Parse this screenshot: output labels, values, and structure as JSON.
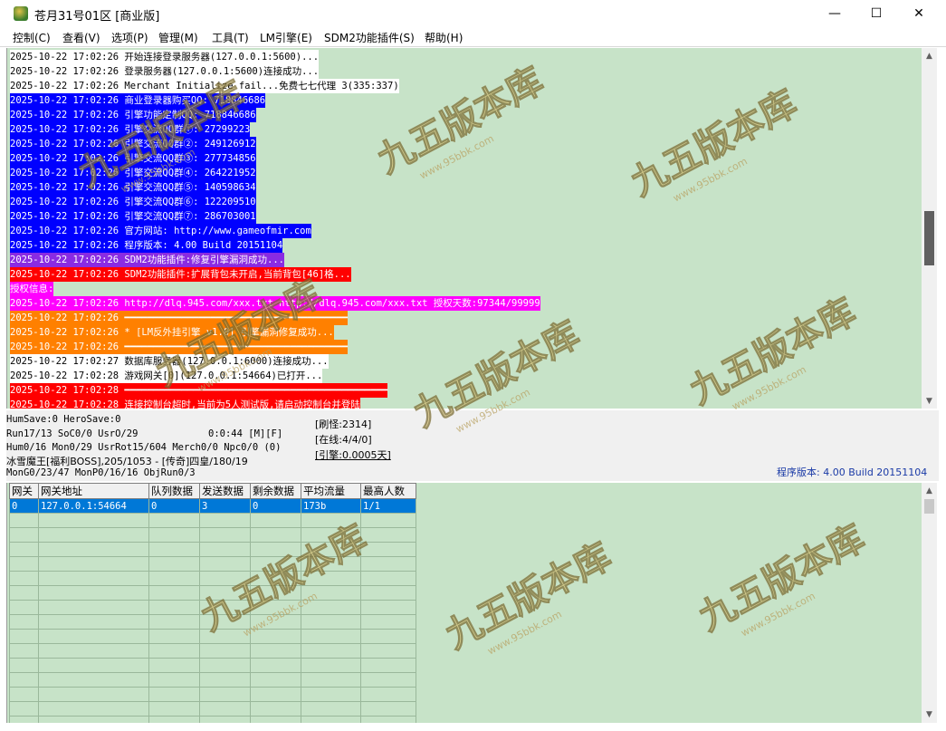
{
  "window": {
    "title": "苍月31号01区 [商业版]",
    "controls": {
      "minimize": "—",
      "maximize": "☐",
      "close": "✕"
    }
  },
  "menu": [
    "控制(C)",
    "查看(V)",
    "选项(P)",
    "管理(M)",
    "工具(T)",
    "LM引擎(E)",
    "SDM2功能插件(S)",
    "帮助(H)"
  ],
  "log": [
    {
      "text": "2025-10-22 17:02:26 开始连接登录服务器(127.0.0.1:5600)...",
      "fg": "#000000",
      "bg": "#ffffff"
    },
    {
      "text": "2025-10-22 17:02:26 登录服务器(127.0.0.1:5600)连接成功...",
      "fg": "#000000",
      "bg": "#ffffff"
    },
    {
      "text": "2025-10-22 17:02:26 Merchant Initialize fail...免费七七代理 3(335:337)",
      "fg": "#000000",
      "bg": "#ffffff"
    },
    {
      "text": "2025-10-22 17:02:26 商业登录器购买QQ: 718846686",
      "fg": "#ffffff",
      "bg": "#0000ff"
    },
    {
      "text": "2025-10-22 17:02:26 引擎功能定制QQ: 718846686",
      "fg": "#ffffff",
      "bg": "#0000ff"
    },
    {
      "text": "2025-10-22 17:02:26 引擎交流QQ群①: 27299223",
      "fg": "#ffffff",
      "bg": "#0000ff"
    },
    {
      "text": "2025-10-22 17:02:26 引擎交流QQ群②: 249126912",
      "fg": "#ffffff",
      "bg": "#0000ff"
    },
    {
      "text": "2025-10-22 17:02:26 引擎交流QQ群③: 277734856",
      "fg": "#ffffff",
      "bg": "#0000ff"
    },
    {
      "text": "2025-10-22 17:02:26 引擎交流QQ群④: 264221952",
      "fg": "#ffffff",
      "bg": "#0000ff"
    },
    {
      "text": "2025-10-22 17:02:26 引擎交流QQ群⑤: 140598634",
      "fg": "#ffffff",
      "bg": "#0000ff"
    },
    {
      "text": "2025-10-22 17:02:26 引擎交流QQ群⑥: 122209510",
      "fg": "#ffffff",
      "bg": "#0000ff"
    },
    {
      "text": "2025-10-22 17:02:26 引擎交流QQ群⑦: 286703001",
      "fg": "#ffffff",
      "bg": "#0000ff"
    },
    {
      "text": "2025-10-22 17:02:26 官方网站: http://www.gameofmir.com",
      "fg": "#ffffff",
      "bg": "#0000ff"
    },
    {
      "text": "2025-10-22 17:02:26 程序版本: 4.00 Build 20151104",
      "fg": "#ffffff",
      "bg": "#0000ff"
    },
    {
      "text": "2025-10-22 17:02:26 SDM2功能插件:修复引擎漏洞成功...",
      "fg": "#ffffff",
      "bg": "#8a2be2"
    },
    {
      "text": "2025-10-22 17:02:26 SDM2功能插件:扩展背包未开启,当前背包[46]格...",
      "fg": "#ffffff",
      "bg": "#ff0000"
    },
    {
      "text": "授权信息:",
      "fg": "#ffffff",
      "bg": "#ff00ff"
    },
    {
      "text": "2025-10-22 17:02:26 http://dlq.945.com/xxx.txt http://dlq.945.com/xxx.txt 授权天数:97344/99999",
      "fg": "#ffffff",
      "bg": "#ff00ff"
    },
    {
      "text": "2025-10-22 17:02:26 ━━━━━━━━━━━━━━━━━━━━━━━━━━━━━━━━━━━━━━━",
      "fg": "#ffffff",
      "bg": "#ff8000"
    },
    {
      "text": "2025-10-22 17:02:26 * [LM反外挂引擎 v1.0] 引擎漏洞修复成功...",
      "fg": "#ffffff",
      "bg": "#ff8000"
    },
    {
      "text": "2025-10-22 17:02:26 ━━━━━━━━━━━━━━━━━━━━━━━━━━━━━━━━━━━━━━━",
      "fg": "#ffffff",
      "bg": "#ff8000"
    },
    {
      "text": "2025-10-22 17:02:27 数据库服务器(127.0.0.1:6000)连接成功...",
      "fg": "#000000",
      "bg": "#ffffff"
    },
    {
      "text": "2025-10-22 17:02:28 游戏网关[0](127.0.0.1:54664)已打开...",
      "fg": "#000000",
      "bg": "#ffffff"
    },
    {
      "text": "2025-10-22 17:02:28 ━━━━━━━━━━━━━━━━━━━━━━━━━━━━━━━━━━━━━━━━━━━━━━",
      "fg": "#ffffff",
      "bg": "#ff0000"
    },
    {
      "text": "2025-10-22 17:02:28 连接控制台超时,当前为5人测试版,请启动控制台并登陆",
      "fg": "#ffffff",
      "bg": "#ff0000"
    }
  ],
  "status": {
    "line1": "HumSave:0 HeroSave:0",
    "line2": "Run17/13 SoC0/0 UsrO/29",
    "line3": "Hum0/16 Mon0/29 UsrRot15/604 Merch0/0 Npc0/0 (0)",
    "line4": "冰雪魔王[福利BOSS],205/1053 - [传奇]四皇/180/19",
    "line5": "MonG0/23/47 MonP0/16/16 ObjRun0/3",
    "timer": "0:0:44 [M][F]",
    "refresh": "[刷怪:2314]",
    "online": "[在线:4/4/0]",
    "engine": "[引擎:0.0005天]",
    "version": "程序版本: 4.00 Build 20151104"
  },
  "grid": {
    "headers": [
      "网关",
      "网关地址",
      "队列数据",
      "发送数据",
      "剩余数据",
      "平均流量",
      "最高人数"
    ],
    "rows": [
      [
        "0",
        "127.0.0.1:54664",
        "0",
        "3",
        "0",
        "173b",
        "1/1"
      ]
    ]
  },
  "watermark": {
    "text": "九五版本库",
    "url": "www.95bbk.com"
  }
}
